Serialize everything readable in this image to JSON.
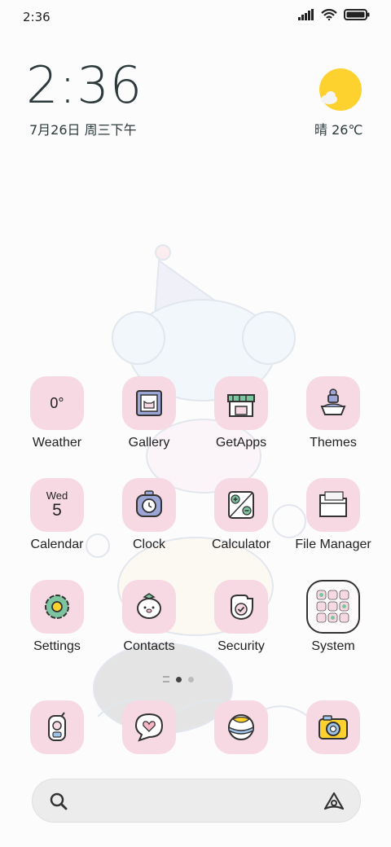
{
  "status_bar": {
    "time": "2:36"
  },
  "clock_widget": {
    "time": "2:36",
    "date": "7月26日 周三下午"
  },
  "weather_widget": {
    "text": "晴 26℃"
  },
  "apps": {
    "weather": {
      "label": "Weather",
      "tile_text": "0°"
    },
    "gallery": {
      "label": "Gallery"
    },
    "getapps": {
      "label": "GetApps"
    },
    "themes": {
      "label": "Themes"
    },
    "calendar": {
      "label": "Calendar",
      "day": "Wed",
      "date": "5"
    },
    "clock": {
      "label": "Clock"
    },
    "calculator": {
      "label": "Calculator"
    },
    "file_manager": {
      "label": "File Manager"
    },
    "settings": {
      "label": "Settings"
    },
    "contacts": {
      "label": "Contacts"
    },
    "security": {
      "label": "Security"
    },
    "system": {
      "label": "System"
    }
  },
  "dock": [
    "phone-walkie-icon",
    "message-heart-icon",
    "browser-ball-icon",
    "camera-icon"
  ],
  "colors": {
    "tile": "#f6d9e3",
    "sun": "#fdd22f",
    "accent_text": "#2c3a3c"
  }
}
